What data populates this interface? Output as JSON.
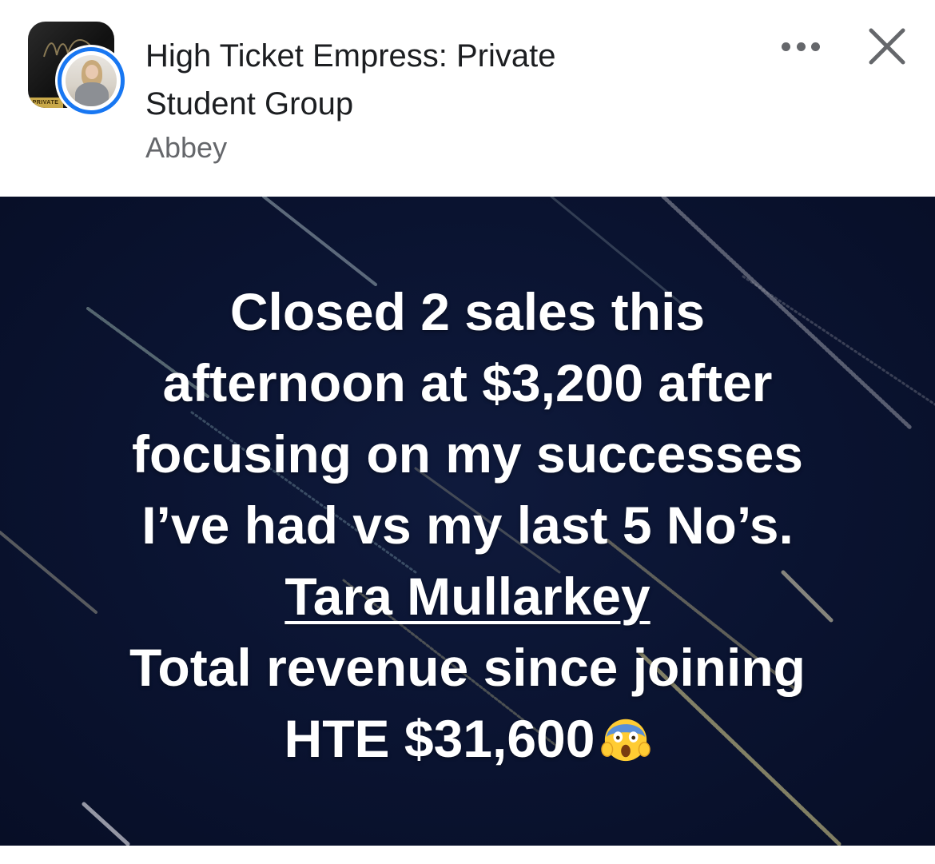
{
  "header": {
    "group_name": "High Ticket Empress: Private Student Group",
    "group_name_line1": "High Ticket Empress: Private",
    "group_name_line2": "Student Group",
    "author": "Abbey",
    "private_tag": "PRIVATE",
    "more_icon": "more-horizontal-icon",
    "close_icon": "close-icon"
  },
  "post": {
    "lines": [
      "Closed 2 sales this",
      "afternoon at $3,200 after",
      "focusing on my successes",
      "I’ve had vs my last 5 No’s."
    ],
    "mention": "Tara Mullarkey",
    "line_after_1": "Total revenue since joining",
    "line_after_2": "HTE $31,600",
    "emoji": "screaming-face-emoji",
    "background_color": "#0a1330"
  },
  "colors": {
    "accent": "#1877f2",
    "text_primary": "#1c1e21",
    "text_secondary": "#65676b"
  }
}
